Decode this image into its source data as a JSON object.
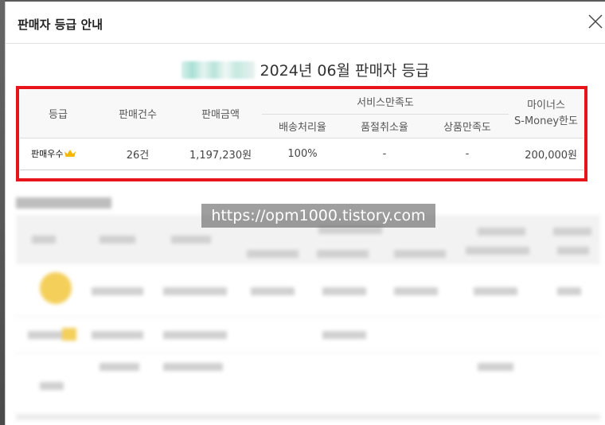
{
  "modal": {
    "title": "판매자 등급 안내",
    "close_icon": "close-icon"
  },
  "heading": {
    "text": "2024년 06월 판매자 등급"
  },
  "grade_table": {
    "headers": {
      "grade": "등급",
      "sales_count": "판매건수",
      "sales_amount": "판매금액",
      "service_satisfaction": "서비스만족도",
      "shipping": "배송처리율",
      "out_of_stock_cancel": "품절취소율",
      "product_satisfaction": "상품만족도",
      "minus_line1": "마이너스",
      "minus_line2": "S-Money한도"
    },
    "row": {
      "grade": "판매우수",
      "grade_icon": "crown-icon",
      "sales_count": "26건",
      "sales_amount": "1,197,230원",
      "shipping": "100%",
      "out_of_stock_cancel": "-",
      "product_satisfaction": "-",
      "minus_limit": "200,000원"
    }
  },
  "watermark": "https://opm1000.tistory.com",
  "colors": {
    "highlight": "#e8141c",
    "crown": "#f5b800"
  }
}
